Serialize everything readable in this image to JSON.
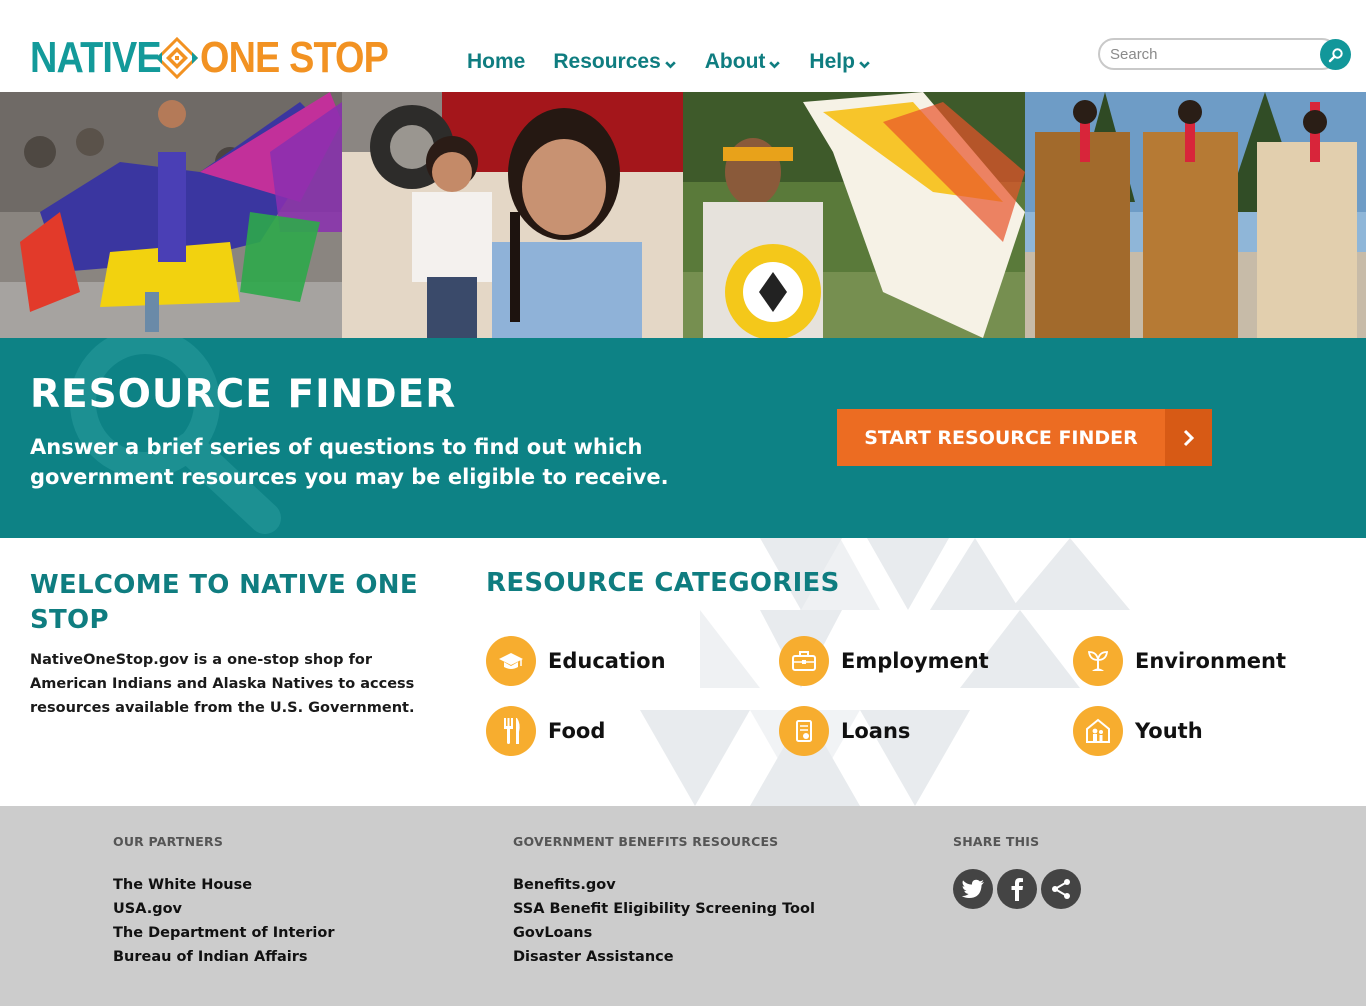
{
  "header": {
    "logo": {
      "part1": "NATIVE",
      "part2": "ONE STOP"
    },
    "nav": [
      {
        "label": "Home",
        "dropdown": false
      },
      {
        "label": "Resources",
        "dropdown": true
      },
      {
        "label": "About",
        "dropdown": true
      },
      {
        "label": "Help",
        "dropdown": true
      }
    ],
    "search": {
      "placeholder": "Search",
      "value": ""
    }
  },
  "finder": {
    "title": "RESOURCE FINDER",
    "description": "Answer a brief series of questions to find out which government resources you may be eligible to receive.",
    "button_label": "START RESOURCE FINDER"
  },
  "welcome": {
    "title": "WELCOME TO NATIVE ONE STOP",
    "text": "NativeOneStop.gov is a one-stop shop for American Indians and Alaska Natives to access resources available from the U.S. Government."
  },
  "categories": {
    "title": "RESOURCE CATEGORIES",
    "items": [
      {
        "label": "Education",
        "icon": "graduation-cap-icon"
      },
      {
        "label": "Employment",
        "icon": "briefcase-icon"
      },
      {
        "label": "Environment",
        "icon": "sprout-icon"
      },
      {
        "label": "Food",
        "icon": "fork-knife-icon"
      },
      {
        "label": "Loans",
        "icon": "loan-document-icon"
      },
      {
        "label": "Youth",
        "icon": "family-house-icon"
      }
    ]
  },
  "footer": {
    "partners": {
      "heading": "OUR PARTNERS",
      "links": [
        "The White House",
        "USA.gov",
        "The Department of Interior",
        "Bureau of Indian Affairs"
      ]
    },
    "benefits": {
      "heading": "GOVERNMENT BENEFITS RESOURCES",
      "links": [
        "Benefits.gov",
        "SSA Benefit Eligibility Screening Tool",
        "GovLoans",
        "Disaster Assistance"
      ]
    },
    "share": {
      "heading": "SHARE THIS",
      "buttons": [
        "twitter-icon",
        "facebook-icon",
        "share-icon"
      ]
    }
  },
  "colors": {
    "teal": "#0d8285",
    "teal_text": "#0f7d80",
    "orange": "#ec6c22",
    "logo_orange": "#f29222",
    "category_yellow": "#f7ad2f",
    "footer_gray": "#cccccc"
  }
}
